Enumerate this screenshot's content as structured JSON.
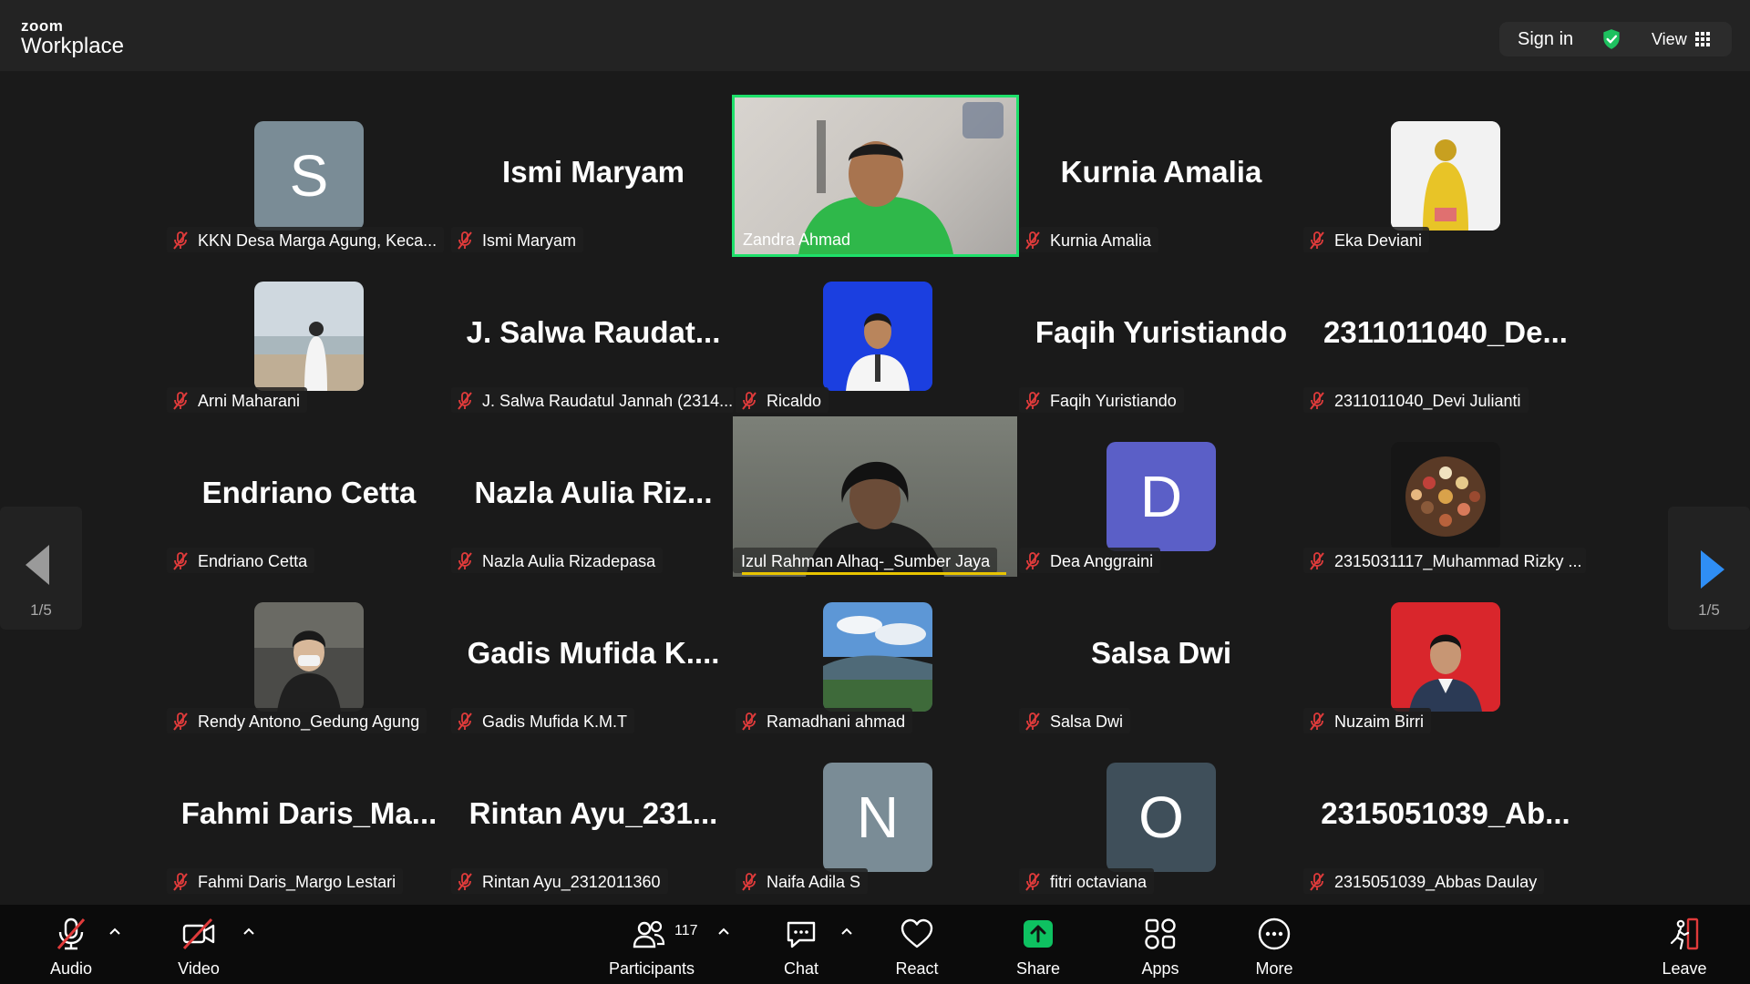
{
  "app": {
    "logo_line1": "zoom",
    "logo_line2": "Workplace"
  },
  "topbar": {
    "sign_in": "Sign in",
    "view": "View"
  },
  "colors": {
    "accent": "#1ee06a",
    "share_green": "#0ec161",
    "mute_red": "#e03b3b",
    "arrow_blue": "#2f8ef5"
  },
  "pager": {
    "left": "1/5",
    "right": "1/5"
  },
  "tiles": [
    {
      "label": "KKN Desa Marga Agung, Keca...",
      "letter": "S"
    },
    {
      "label": "Ismi Maryam",
      "big": "Ismi Maryam"
    },
    {
      "label": "Zandra Ahmad"
    },
    {
      "label": "Kurnia Amalia",
      "big": "Kurnia Amalia"
    },
    {
      "label": "Eka Deviani"
    },
    {
      "label": "Arni Maharani"
    },
    {
      "label": "J. Salwa Raudatul Jannah (2314...",
      "big": "J.  Salwa  Raudat..."
    },
    {
      "label": "Ricaldo"
    },
    {
      "label": "Faqih Yuristiando",
      "big": "Faqih Yuristiando"
    },
    {
      "label": "2311011040_Devi Julianti",
      "big": "2311011040_De..."
    },
    {
      "label": "Endriano Cetta",
      "big": "Endriano Cetta"
    },
    {
      "label": "Nazla Aulia Rizadepasa",
      "big": "Nazla  Aulia  Riz..."
    },
    {
      "label": "Izul Rahman Alhaq-_Sumber Jaya"
    },
    {
      "label": "Dea Anggraini",
      "letter": "D"
    },
    {
      "label": "2315031117_Muhammad Rizky ..."
    },
    {
      "label": "Rendy Antono_Gedung Agung"
    },
    {
      "label": "Gadis Mufida K.M.T",
      "big": "Gadis  Mufida  K...."
    },
    {
      "label": "Ramadhani ahmad"
    },
    {
      "label": "Salsa Dwi",
      "big": "Salsa Dwi"
    },
    {
      "label": "Nuzaim Birri"
    },
    {
      "label": "Fahmi Daris_Margo Lestari",
      "big": "Fahmi  Daris_Ma..."
    },
    {
      "label": "Rintan Ayu_2312011360",
      "big": "Rintan  Ayu_231..."
    },
    {
      "label": "Naifa Adila S",
      "letter": "N"
    },
    {
      "label": "fitri octaviana",
      "letter": "O"
    },
    {
      "label": "2315051039_Abbas Daulay",
      "big": "2315051039_Ab..."
    }
  ],
  "toolbar": {
    "audio": "Audio",
    "video": "Video",
    "participants": "Participants",
    "participant_count": "117",
    "chat": "Chat",
    "react": "React",
    "share": "Share",
    "apps": "Apps",
    "more": "More",
    "leave": "Leave"
  }
}
